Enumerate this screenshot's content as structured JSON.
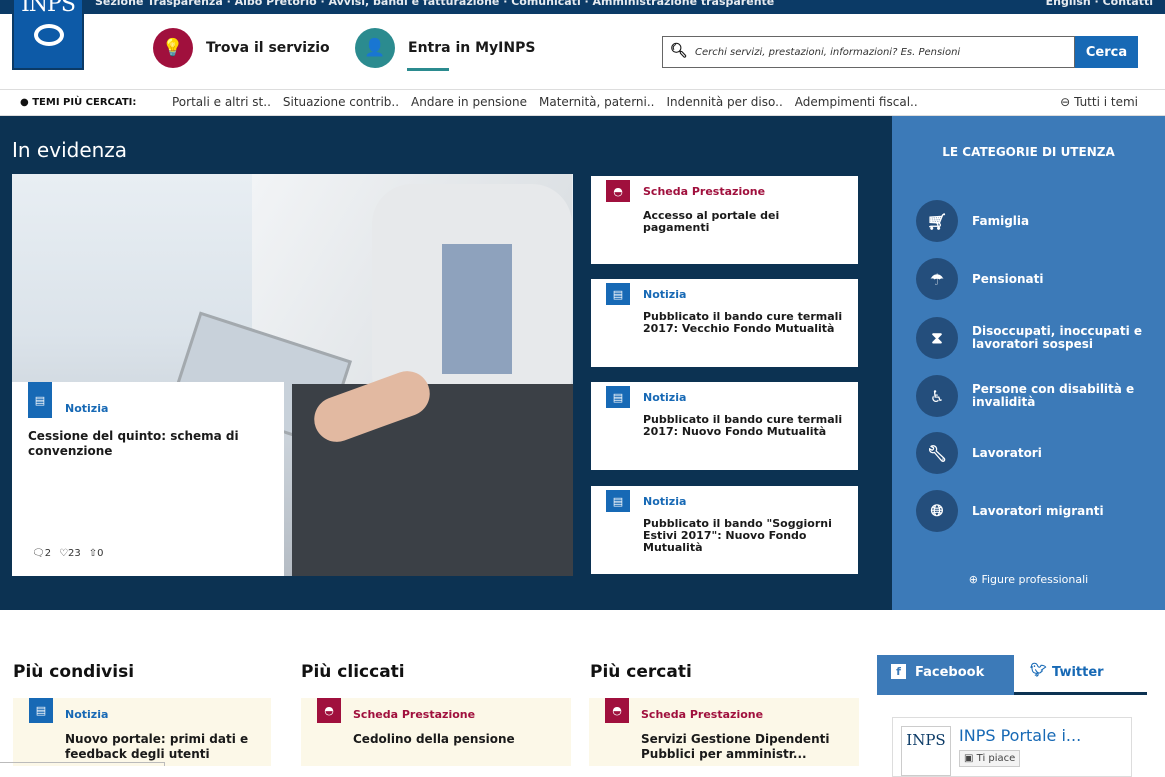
{
  "topbar": {
    "left_text": "Sezione Trasparenza · Albo Pretorio · Avvisi, bandi e fatturazione · Comunicati · Amministrazione trasparente",
    "right_text": "English · Contatti"
  },
  "logo": {
    "text": "INPS"
  },
  "header": {
    "service_label": "Trova il servizio",
    "myinps_label": "Entra in MyINPS",
    "search_placeholder": "Cerchi servizi, prestazioni, informazioni? Es. Pensioni",
    "search_button": "Cerca"
  },
  "temi": {
    "label": "TEMI PIÙ CERCATI:",
    "items": [
      "Portali e altri st..",
      "Situazione contrib..",
      "Andare in pensione",
      "Maternità, paterni..",
      "Indennità per diso..",
      "Adempimenti fiscal.."
    ],
    "all": "Tutti i temi"
  },
  "hero": {
    "title": "In evidenza",
    "main": {
      "type": "Notizia",
      "title": "Cessione del quinto: schema di convenzione",
      "comments": "2",
      "likes": "23",
      "shares": "0"
    },
    "cards": [
      {
        "type": "Scheda Prestazione",
        "title": "Accesso al portale dei pagamenti"
      },
      {
        "type": "Notizia",
        "title": "Pubblicato il bando cure termali 2017: Vecchio Fondo Mutualità"
      },
      {
        "type": "Notizia",
        "title": "Pubblicato il bando cure termali 2017: Nuovo Fondo Mutualità"
      },
      {
        "type": "Notizia",
        "title": "Pubblicato il bando \"Soggiorni Estivi 2017\": Nuovo Fondo Mutualità"
      }
    ]
  },
  "categories": {
    "title": "LE CATEGORIE DI UTENZA",
    "items": [
      {
        "label": "Famiglia",
        "icon": "stroller-icon"
      },
      {
        "label": "Pensionati",
        "icon": "umbrella-icon"
      },
      {
        "label": "Disoccupati, inoccupati e lavoratori sospesi",
        "icon": "hourglass-icon"
      },
      {
        "label": "Persone con disabilità e invalidità",
        "icon": "wheelchair-icon"
      },
      {
        "label": "Lavoratori",
        "icon": "wrench-icon"
      },
      {
        "label": "Lavoratori migranti",
        "icon": "globe-icon"
      }
    ],
    "figure": "Figure professionali"
  },
  "lists": {
    "condivisi": {
      "title": "Più condivisi",
      "type": "Notizia",
      "item": "Nuovo portale: primi dati e feedback degli utenti"
    },
    "cliccati": {
      "title": "Più cliccati",
      "type": "Scheda Prestazione",
      "item": "Cedolino della pensione"
    },
    "cercati": {
      "title": "Più cercati",
      "type": "Scheda Prestazione",
      "item": "Servizi Gestione Dipendenti Pubblici per amministr..."
    }
  },
  "social": {
    "facebook": "Facebook",
    "twitter": "Twitter",
    "page_name": "INPS Portale i...",
    "like": "Ti piace",
    "logo_text": "INPS"
  },
  "colors": {
    "navy": "#0c3252",
    "blue": "#1769b5",
    "crimson": "#a0103d",
    "teal": "#2b8b8f",
    "cat_bg": "#3c7ab8"
  }
}
